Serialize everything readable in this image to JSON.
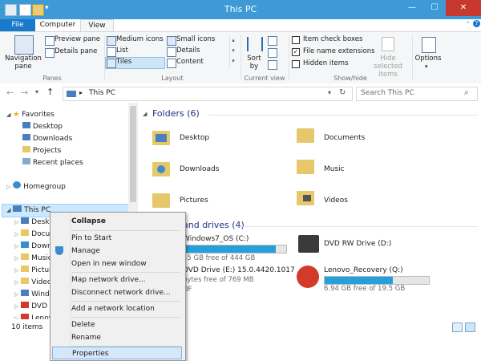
{
  "window": {
    "title": "This PC"
  },
  "tabs": {
    "file": "File",
    "computer": "Computer",
    "view": "View"
  },
  "ribbon": {
    "panes": {
      "navigation_pane": "Navigation\npane",
      "preview_pane": "Preview pane",
      "details_pane": "Details pane",
      "group": "Panes"
    },
    "layout": {
      "medium_icons": "Medium icons",
      "small_icons": "Small icons",
      "list": "List",
      "details": "Details",
      "tiles": "Tiles",
      "content": "Content",
      "group": "Layout"
    },
    "current_view": {
      "sort_by": "Sort\nby",
      "group": "Current view"
    },
    "show_hide": {
      "item_check_boxes": "Item check boxes",
      "file_name_extensions": "File name extensions",
      "hidden_items": "Hidden items",
      "hide_selected": "Hide selected\nitems",
      "group": "Show/hide"
    },
    "options": "Options"
  },
  "address": {
    "path": "This PC",
    "search_placeholder": "Search This PC"
  },
  "nav": {
    "favorites": "Favorites",
    "favorites_items": [
      "Desktop",
      "Downloads",
      "Projects",
      "Recent places"
    ],
    "homegroup": "Homegroup",
    "this_pc": "This PC",
    "this_pc_items": [
      "Deskto",
      "Docum",
      "Downl",
      "Music",
      "Pictur",
      "Videos",
      "Windo",
      "DVD D",
      "Lenov"
    ]
  },
  "content": {
    "folders_header": "Folders (6)",
    "folders": [
      "Desktop",
      "Documents",
      "Downloads",
      "Music",
      "Pictures",
      "Videos"
    ],
    "drives_header": "and drives (4)",
    "drives": [
      {
        "name": "Windows7_OS (C:)",
        "sub": "45 GB free of 444 GB",
        "fill": 0.9
      },
      {
        "name": "DVD RW Drive (D:)",
        "sub": ""
      },
      {
        "name": "DVD Drive (E:) 15.0.4420.1017",
        "sub": "bytes free of 769 MB",
        "sub2": "DF"
      },
      {
        "name": "Lenovo_Recovery (Q:)",
        "sub": "6.94 GB free of 19.5 GB",
        "fill": 0.65
      }
    ]
  },
  "status": {
    "items": "10 items"
  },
  "menu": {
    "collapse": "Collapse",
    "pin_to_start": "Pin to Start",
    "manage": "Manage",
    "open_new_window": "Open in new window",
    "map_network_drive": "Map network drive...",
    "disconnect_network_drive": "Disconnect network drive...",
    "add_network_location": "Add a network location",
    "delete": "Delete",
    "rename": "Rename",
    "properties": "Properties"
  },
  "colors": {
    "titlebar": "#3d9ad7",
    "file_tab": "#1979ca",
    "accent_text": "#1e3287",
    "drive_fill": "#26a0da"
  }
}
